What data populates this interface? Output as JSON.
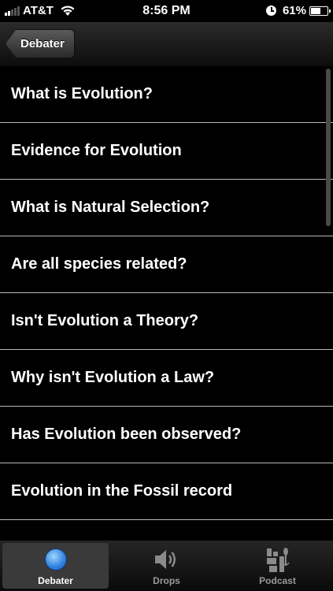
{
  "status_bar": {
    "carrier": "AT&T",
    "time": "8:56 PM",
    "battery": "61%"
  },
  "nav": {
    "back_label": "Debater"
  },
  "list": {
    "items": [
      "What is Evolution?",
      "Evidence for Evolution",
      "What is Natural Selection?",
      "Are all species related?",
      "Isn't Evolution a Theory?",
      "Why isn't Evolution a Law?",
      "Has Evolution been observed?",
      "Evolution in the Fossil record"
    ]
  },
  "tabs": [
    {
      "label": "Debater",
      "icon": "blue-dot-icon",
      "active": true
    },
    {
      "label": "Drops",
      "icon": "speaker-icon",
      "active": false
    },
    {
      "label": "Podcast",
      "icon": "podcast-icon",
      "active": false
    }
  ],
  "colors": {
    "active_tab_icon": "#2f7fe0",
    "divider": "#b8b8b8"
  }
}
